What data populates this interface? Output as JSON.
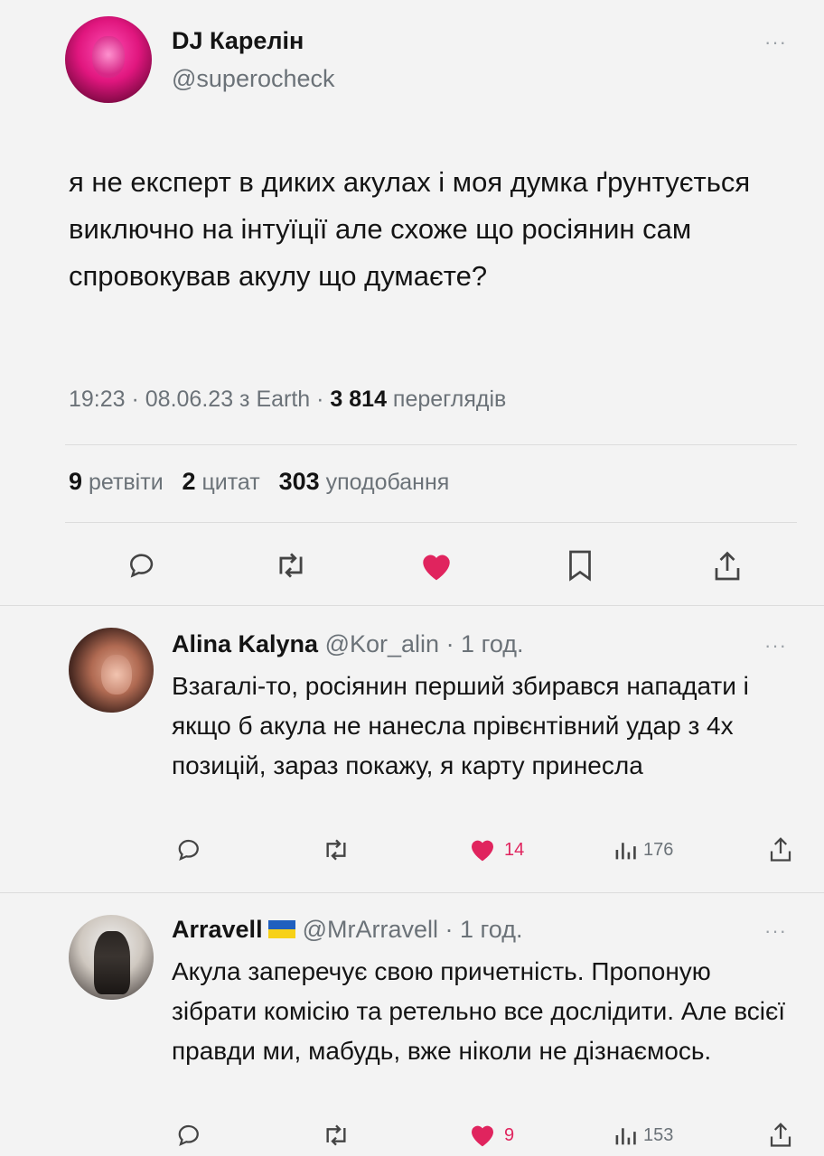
{
  "main_tweet": {
    "author_name": "DJ Карелін",
    "author_handle": "@superocheck",
    "more": "···",
    "text": "я не експерт в диких акулах і моя думка ґрунтується виключно на інтуїції але схоже що росіянин сам спровокував акулу що думаєте?",
    "time": "19:23 · 08.06.23 з Earth · ",
    "views_count": "3 814",
    "views_label": " переглядів",
    "retweets_count": "9",
    "retweets_label": " ретвіти",
    "quotes_count": "2",
    "quotes_label": " цитат",
    "likes_count": "303",
    "likes_label": " уподобання",
    "actions": [
      "reply-icon",
      "retweet-icon",
      "heart-icon",
      "bookmark-icon",
      "share-icon"
    ],
    "like_color": "#e0245e"
  },
  "replies": [
    {
      "author_name": "Alina Kalyna",
      "author_handle": "@Kor_alin",
      "time": " · 1 год.",
      "more": "···",
      "text": "Взагалі-то, росіянин перший збирався нападати і якщо б акула не нанесла прівєнтівний удар з 4х позицій, зараз покажу, я карту принесла",
      "likes": "14",
      "views": "176"
    },
    {
      "author_name": "Arravell",
      "author_handle": "@MrArravell",
      "time": " · 1 год.",
      "more": "···",
      "text": "Акула заперечує свою причетність. Пропоную зібрати комісію та ретельно все дослідити. Але всієї правди ми, мабудь, вже ніколи не дізнаємось.",
      "likes": "9",
      "views": "153"
    }
  ]
}
